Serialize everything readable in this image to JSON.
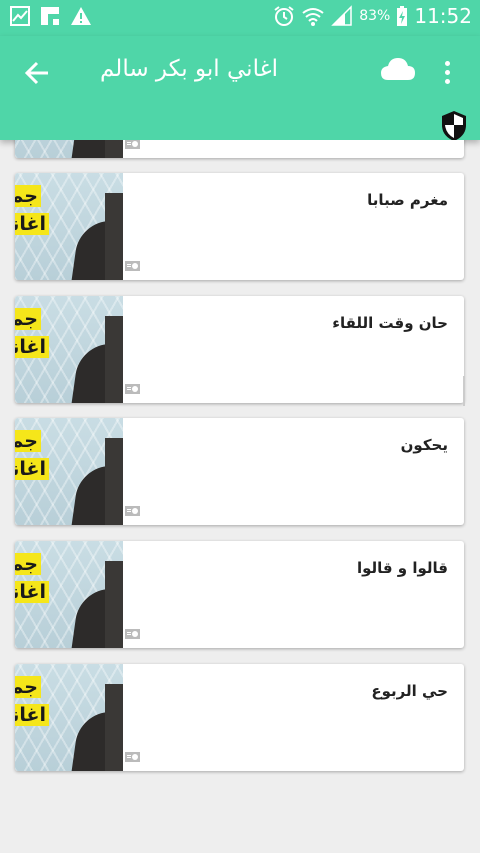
{
  "status_bar": {
    "battery_percent": "83%",
    "time": "11:52",
    "icons": [
      "image-icon",
      "flipboard-icon",
      "warning-icon",
      "alarm-icon",
      "wifi-icon",
      "signal-icon",
      "battery-charging-icon"
    ]
  },
  "appbar": {
    "title": "اغاني ابو بكر سالم",
    "back_icon": "arrow-left-icon",
    "cloud_icon": "cloud-icon",
    "menu_icon": "more-vert-icon",
    "shield_icon": "shield-icon"
  },
  "colors": {
    "primary": "#4fd6a8",
    "background": "#eeeeee",
    "card": "#ffffff",
    "title_text": "#222222"
  },
  "thumbnail_text": {
    "line1": "جميع",
    "line2": "اغاني"
  },
  "songs": [
    {
      "title": ""
    },
    {
      "title": "مغرم صبابا"
    },
    {
      "title": "حان وقت اللقاء"
    },
    {
      "title": "يحكون"
    },
    {
      "title": "قالوا و قالوا"
    },
    {
      "title": "حي الربوع"
    }
  ]
}
